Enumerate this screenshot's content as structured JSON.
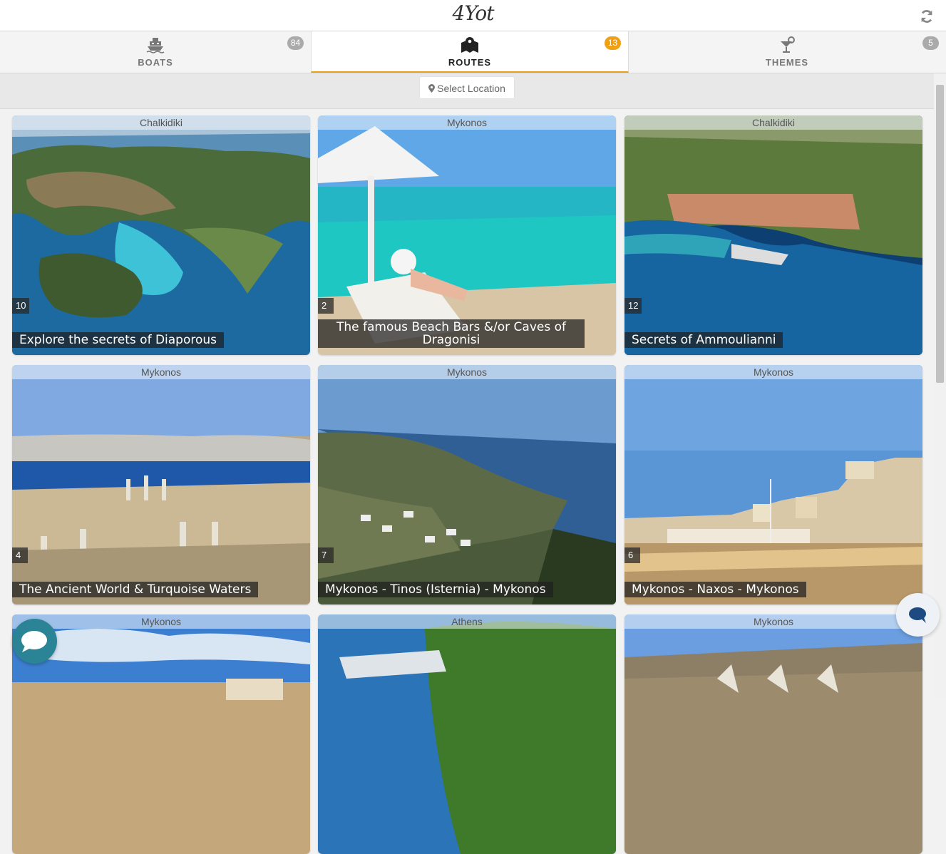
{
  "header": {
    "logo": "4Yot",
    "refresh_icon": "refresh-icon"
  },
  "tabs": [
    {
      "label": "BOATS",
      "count": "84",
      "icon": "boat-icon",
      "active": false
    },
    {
      "label": "ROUTES",
      "count": "13",
      "icon": "map-icon",
      "active": true
    },
    {
      "label": "THEMES",
      "count": "5",
      "icon": "cocktail-icon",
      "active": false
    }
  ],
  "location": {
    "button_label": "Select Location",
    "icon": "map-marker-icon"
  },
  "cards": [
    {
      "region": "Chalkidiki",
      "count": "10",
      "title": "Explore the secrets of Diaporous"
    },
    {
      "region": "Mykonos",
      "count": "2",
      "title": "The famous Beach Bars &/or Caves of Dragonisi"
    },
    {
      "region": "Chalkidiki",
      "count": "12",
      "title": "Secrets of Ammoulianni"
    },
    {
      "region": "Mykonos",
      "count": "4",
      "title": "The Ancient World & Turquoise Waters"
    },
    {
      "region": "Mykonos",
      "count": "7",
      "title": "Mykonos - Tinos (Isternia) - Mykonos"
    },
    {
      "region": "Mykonos",
      "count": "6",
      "title": "Mykonos - Naxos - Mykonos"
    },
    {
      "region": "Mykonos"
    },
    {
      "region": "Athens"
    },
    {
      "region": "Mykonos"
    }
  ],
  "colors": {
    "accent": "#f0a013",
    "chat": "#2b8496"
  }
}
